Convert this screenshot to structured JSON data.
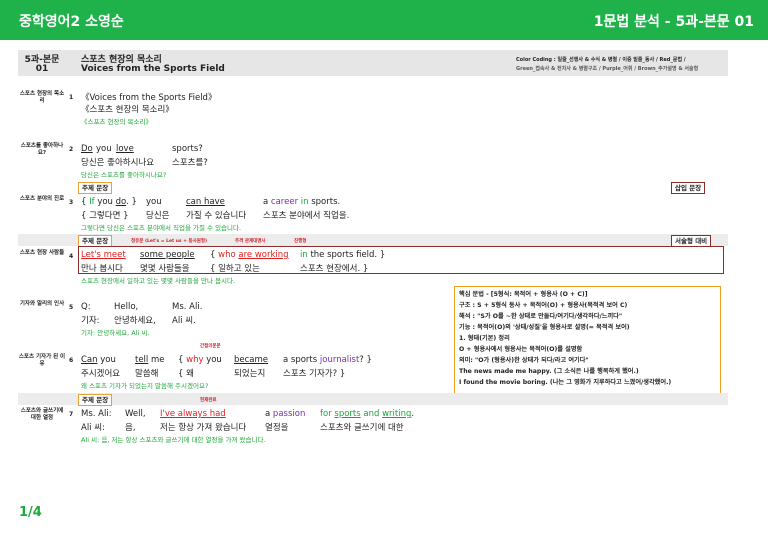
{
  "header": {
    "left_title": "중학영어2 소영순",
    "right_title": "1문법 분석 - 5과-본문 01"
  },
  "title_block": {
    "lesson_line1": "5과-본문",
    "lesson_line2": "01",
    "title_ko": "스포츠 현장의 목소리",
    "title_en": "Voices from the Sports Field",
    "color_coding_line1": "Color Coding : 일줄_선행사 & 수식 & 병렬 / 이중 밑줄_동사 / Red_문법 /",
    "color_coding_line2": "Green_접속사 & 전치사 & 병렬구조 / Purple_어휘 / Brown_추가설명 & 서술형"
  },
  "sections": [
    {
      "label": "스포츠 현장의 목소리",
      "num": "1",
      "en": "《Voices from the Sports Field》",
      "ko": "《스포츠 현장의 목소리》",
      "tr": "《스포츠 현장의 목소리》"
    },
    {
      "label": "스포츠를 좋아하나요?",
      "num": "2",
      "en_a": "Do",
      "en_b": "you",
      "en_c": "love",
      "en_d": "sports?",
      "ko_a": "당신은 좋아하시나요",
      "ko_b": "스포츠를?",
      "tr": "당신은 스포츠를 좋아하시나요?"
    },
    {
      "label": "스포츠 분야의 진로",
      "num": "3",
      "en_a": "{ ",
      "en_if": "If",
      " en_you": "you",
      "en_do": "do",
      "en_b": ". }",
      "en_you2": "you",
      "en_can": "can have",
      "en_a_career": "a career",
      "en_in": "in",
      "en_sports": "sports.",
      "ko_a": "{ 그렇다면 }",
      "ko_b": "당신은",
      "ko_c": "가질 수 있습니다",
      "ko_d": "스포츠 분야에서 직업을.",
      "tr": "그렇다면 당신은 스포츠 분야에서 직업을 가질 수 있습니다."
    },
    {
      "label": "스포츠 현장 사람들",
      "num": "4",
      "en_lets": "Let's meet",
      "en_some": "some people",
      "en_brace": "{",
      "en_who": "who",
      "en_are": "are working",
      "en_in": "in",
      "en_field": "the sports field. }",
      "ko_a": "만나 봅시다",
      "ko_b": "몇몇 사람들을",
      "ko_c": "{ 일하고 있는",
      "ko_d": "스포츠 현장에서. }",
      "tr": "스포츠 현장에서 일하고 있는 몇몇 사람들을 만나 봅시다."
    },
    {
      "label": "기자와 알리의 인사",
      "num": "5",
      "en_a": "Q:",
      "en_b": "Hello,",
      "en_c": "Ms. Ali.",
      "ko_a": "기자:",
      "ko_b": "안녕하세요,",
      "ko_c": "Ali 씨.",
      "tr": "기자: 안녕하세요, Ali 씨."
    },
    {
      "label": "스포츠 기자가 된 이유",
      "num": "6",
      "en_can": "Can",
      "en_you": "you",
      "en_tell": "tell",
      "en_me": "me",
      "en_brace": "{",
      "en_why": "why",
      "en_you2": "you",
      "en_became": "became",
      "en_a_sports": "a sports",
      "en_journalist": "journalist",
      "en_end": "? }",
      "ko_a": "주시겠어요",
      "ko_b": "말씀해",
      "ko_c": "{ 왜",
      "ko_d": "되었는지",
      "ko_e": "스포츠 기자가? }",
      "tr": "왜 스포츠 기자가 되었는지 말씀해 주시겠어요?"
    },
    {
      "label": "스포츠와 글쓰기에 대한 열정",
      "num": "7",
      "en_a": "Ms. Ali:",
      "en_b": "Well,",
      "en_c": "I've always had",
      "en_d": "a passion",
      "en_for": "for",
      "en_sports": "sports",
      "en_and": "and",
      "en_writing": "writing",
      "en_dot": ".",
      "ko_a": "Ali 씨:",
      "ko_b": "음,",
      "ko_c": "저는 항상 가져 왔습니다",
      "ko_d": "열정을",
      "ko_e": "스포츠와 글쓰기에 대한",
      "tr": "Ali 씨: 음, 저는 항상 스포츠와 글쓰기에 대한 열정을 가져 왔습니다."
    }
  ],
  "tags": {
    "main1": "주제 문장",
    "insert": "삽입 문장",
    "main2": "주제 문장",
    "desc": "서술형 대비",
    "main3": "주제 문장"
  },
  "annotations": {
    "a1": "청유문 (Let's = Let us + 동사원형)",
    "a2": "주격 관계대명사",
    "a3": "진행형",
    "a4": "간접의문문",
    "a5": "현재완료"
  },
  "grammar_box": {
    "lines": [
      "핵심 문법 - [5형식: 목적어 + 형용사 (O + C)]",
      "구조 : S + 5형식 동사 + 목적어(O) + 형용사(목적격 보어 C)",
      "해석 : \"S가 O를 ~한 상태로 만들다/여기다/생각하다/느끼다\"",
      "기능 : 목적어(O)의 '상태/성질'을 형용사로 설명(= 목적격 보어)",
      "1. 형태(기본) 정리",
      "O + 형용사에서 형용사는 목적어(O)를 설명함",
      "의미: \"O가 (형용사)한 상태가 되다/라고 여기다\"",
      "The news made me happy. (그 소식은 나를 행복하게 했어.)",
      "I found the movie boring. (나는 그 영화가 지루하다고 느꼈어/생각했어.)"
    ]
  },
  "footer": {
    "page": "1/4"
  }
}
